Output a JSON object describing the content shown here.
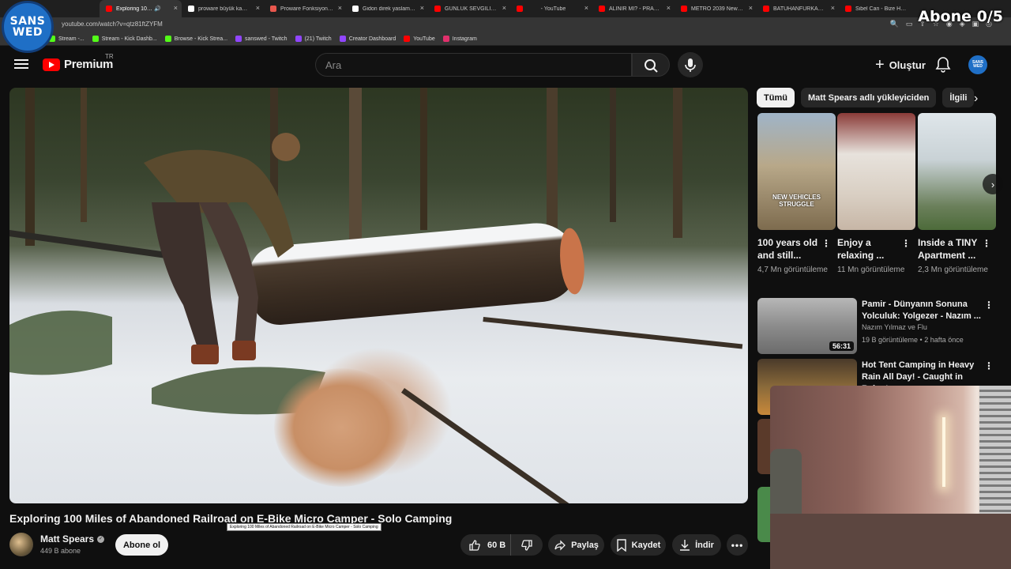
{
  "browser": {
    "tabs": [
      {
        "title": "Exploring 100 Miles o",
        "active": true,
        "favicon_color": "#ff0000"
      },
      {
        "title": "proware büyük kamp ba",
        "active": false,
        "favicon_color": "#ffffff"
      },
      {
        "title": "Proware Fonksiyonel Kam",
        "active": false,
        "favicon_color": "#e8574d"
      },
      {
        "title": "Gidon direk yaslama - G",
        "active": false,
        "favicon_color": "#ffffff"
      },
      {
        "title": "GÜNLÜK SEVGİLİ KİRALA",
        "active": false,
        "favicon_color": "#ff0000"
      },
      {
        "title": "- YouTube",
        "active": false,
        "favicon_color": "#ff0000"
      },
      {
        "title": "ALINIR MI? - PRAGMATA",
        "active": false,
        "favicon_color": "#ff0000"
      },
      {
        "title": "METRO 2039 New Gamep",
        "active": false,
        "favicon_color": "#ff0000"
      },
      {
        "title": "BATUHANFURKANS - HÜ",
        "active": false,
        "favicon_color": "#ff0000"
      },
      {
        "title": "Sibel Can - Bize Has (Slo",
        "active": false,
        "favicon_color": "#ff0000"
      }
    ],
    "url": "youtube.com/watch?v=qtz81ftZYFM",
    "bookmarks": [
      {
        "label": "Stream -...",
        "favicon_color": "#53fc18"
      },
      {
        "label": "Stream - Kick Dashb...",
        "favicon_color": "#53fc18"
      },
      {
        "label": "Browse - Kick Strea...",
        "favicon_color": "#53fc18"
      },
      {
        "label": "sanswed - Twitch",
        "favicon_color": "#9146ff"
      },
      {
        "label": "(21) Twitch",
        "favicon_color": "#9146ff"
      },
      {
        "label": "Creator Dashboard",
        "favicon_color": "#9146ff"
      },
      {
        "label": "YouTube",
        "favicon_color": "#ff0000"
      },
      {
        "label": "Instagram",
        "favicon_color": "#e1306c"
      }
    ]
  },
  "overlay": {
    "logo_line1": "SANS",
    "logo_line2": "WED",
    "sub_counter": "Abone 0/5"
  },
  "header": {
    "logo_word": "Premium",
    "region": "TR",
    "search_placeholder": "Ara",
    "create_label": "Oluştur",
    "avatar_text": "SANS WED"
  },
  "video": {
    "title": "Exploring 100 Miles of Abandoned Railroad on E-Bike Micro Camper - Solo Camping",
    "tooltip": "Exploring 100 Miles of Abandoned Railroad on E-Bike Micro Camper - Solo Camping",
    "channel": "Matt Spears",
    "subscribers": "449 B abone",
    "subscribe_label": "Abone ol",
    "likes": "60 B",
    "share_label": "Paylaş",
    "save_label": "Kaydet",
    "download_label": "İndir"
  },
  "sidebar": {
    "chips": [
      "Tümü",
      "Matt Spears adlı yükleyiciden",
      "İlgili"
    ],
    "shorts": [
      {
        "title": "100 years old and still...",
        "views": "4,7 Mn görüntüleme",
        "caption": "NEW VEHICLES STRUGGLE",
        "thumb_top": "#9fb4c8",
        "thumb_bottom": "#7d6b4e"
      },
      {
        "title": "Enjoy a relaxing ...",
        "views": "11 Mn görüntüleme",
        "caption": "",
        "thumb_top": "#8a3b38",
        "thumb_bottom": "#d9cfc3"
      },
      {
        "title": "Inside a TINY Apartment ...",
        "views": "2,3 Mn görüntüleme",
        "caption": "",
        "thumb_top": "#dfe6ea",
        "thumb_bottom": "#4d6b3a"
      }
    ],
    "recommended": [
      {
        "title": "Pamir - Dünyanın Sonuna Yolculuk: Yolgezer - Nazım ...",
        "channel": "Nazım Yılmaz ve Flu",
        "meta": "19 B görüntüleme • 2 hafta önce",
        "duration": "56:31",
        "thumb_top": "#b7b7b7",
        "thumb_bottom": "#6b6b6b"
      },
      {
        "title": "Hot Tent Camping in Heavy Rain All Day! - Caught in Rainstorm ...",
        "channel": "",
        "meta": "",
        "duration": "",
        "thumb_top": "#4a3a2a",
        "thumb_bottom": "#c9893a"
      }
    ]
  }
}
